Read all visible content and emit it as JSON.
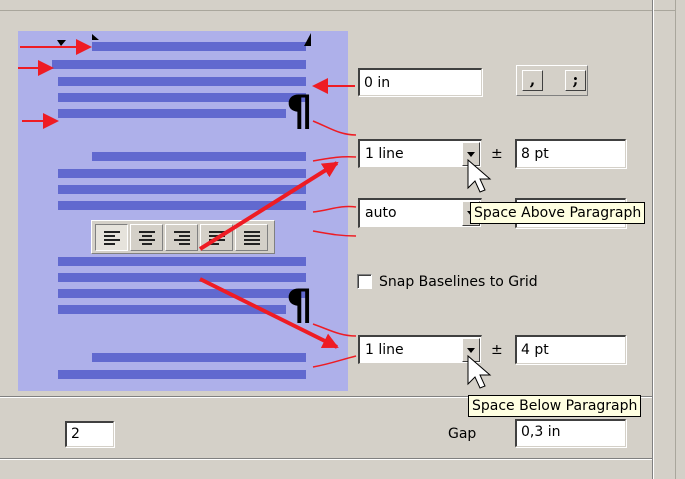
{
  "preview": {
    "pilcrow": "¶"
  },
  "alignment": {
    "buttons": [
      "align-left",
      "align-center",
      "align-right",
      "justify",
      "justify-all"
    ],
    "pressed": "align-left"
  },
  "indent": {
    "value": "0 in"
  },
  "space_above": {
    "mode": "1 line",
    "plusminus": "±",
    "value": "8 pt",
    "tooltip": "Space Above Paragraph"
  },
  "line_spacing": {
    "mode": "auto"
  },
  "snap": {
    "label": "Snap Baselines to Grid",
    "checked": false
  },
  "space_below": {
    "mode": "1 line",
    "plusminus": "±",
    "value": "4 pt",
    "tooltip": "Space Below Paragraph"
  },
  "columns": {
    "count": "2",
    "gap_label": "Gap",
    "gap_value": "0,3 in"
  },
  "colors": {
    "preview_bg": "#aeb0ea",
    "text_bar": "#6169cf",
    "arrow": "#ee1c24"
  }
}
